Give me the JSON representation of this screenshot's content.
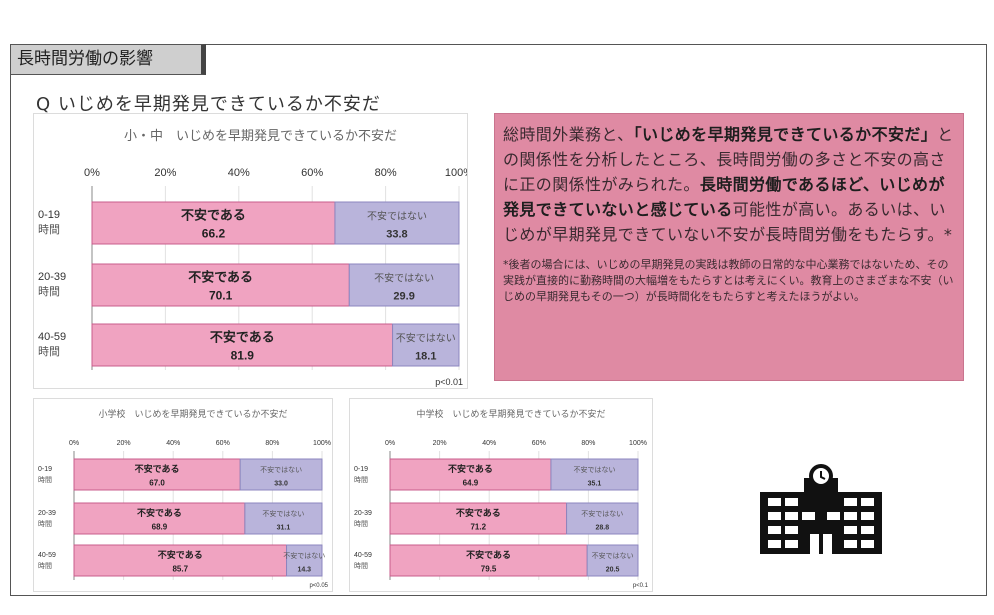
{
  "section_tab": "長時間労働の影響",
  "question": "Q いじめを早期発見できているか不安だ",
  "text_box": {
    "line_parts": [
      {
        "t": "総時間外業務と、",
        "b": false
      },
      {
        "t": "「いじめを早期発見できているか不安だ」",
        "b": true
      },
      {
        "t": "との関係性を分析したところ、長時間労働の多さと不安の高さに正の関係性がみられた。",
        "b": false
      },
      {
        "t": "長時間労働であるほど、いじめが発見できていないと感じている",
        "b": true
      },
      {
        "t": "可能性が高い。あるいは、いじめが早期発見できていない不安が長時間労働をもたらす。*",
        "b": false
      }
    ],
    "note": "*後者の場合には、いじめの早期発見の実践は教師の日常的な中心業務ではないため、その実践が直接的に勤務時間の大幅増をもたらすとは考えにくい。教育上のさまざまな不安（いじめの早期発見もその一つ）が長時間化をもたらすと考えたほうがよい。"
  },
  "colors": {
    "anxious": "#f0a3c1",
    "not_anxious": "#b9b4db",
    "text_box": "#df8aa3"
  },
  "building_icon": "school-building-icon",
  "chart_data": [
    {
      "type": "bar",
      "orientation": "horizontal-stacked-100",
      "title": "小・中　いじめを早期発見できているか不安だ",
      "x_ticks": [
        "0%",
        "20%",
        "40%",
        "60%",
        "80%",
        "100%"
      ],
      "categories": [
        [
          "0-19",
          "時間"
        ],
        [
          "20-39",
          "時間"
        ],
        [
          "40-59",
          "時間"
        ]
      ],
      "series": [
        {
          "name": "不安である",
          "values": [
            66.2,
            70.1,
            81.9
          ],
          "labels": [
            "66.2",
            "70.1",
            "81.9"
          ]
        },
        {
          "name": "不安ではない",
          "values": [
            33.8,
            29.9,
            18.1
          ],
          "labels": [
            "33.8",
            "29.9",
            "18.1"
          ]
        }
      ],
      "note": "p<0.01",
      "xlim": [
        0,
        100
      ]
    },
    {
      "type": "bar",
      "orientation": "horizontal-stacked-100",
      "title": "小学校　いじめを早期発見できているか不安だ",
      "x_ticks": [
        "0%",
        "20%",
        "40%",
        "60%",
        "80%",
        "100%"
      ],
      "categories": [
        [
          "0-19",
          "時間"
        ],
        [
          "20-39",
          "時間"
        ],
        [
          "40-59",
          "時間"
        ]
      ],
      "series": [
        {
          "name": "不安である",
          "values": [
            67.0,
            68.9,
            85.7
          ],
          "labels": [
            "67.0",
            "68.9",
            "85.7"
          ]
        },
        {
          "name": "不安ではない",
          "values": [
            33.0,
            31.1,
            14.3
          ],
          "labels": [
            "33.0",
            "31.1",
            "14.3"
          ]
        }
      ],
      "note": "p<0.05",
      "xlim": [
        0,
        100
      ]
    },
    {
      "type": "bar",
      "orientation": "horizontal-stacked-100",
      "title": "中学校　いじめを早期発見できているか不安だ",
      "x_ticks": [
        "0%",
        "20%",
        "40%",
        "60%",
        "80%",
        "100%"
      ],
      "categories": [
        [
          "0-19",
          "時間"
        ],
        [
          "20-39",
          "時間"
        ],
        [
          "40-59",
          "時間"
        ]
      ],
      "series": [
        {
          "name": "不安である",
          "values": [
            64.9,
            71.2,
            79.5
          ],
          "labels": [
            "64.9",
            "71.2",
            "79.5"
          ]
        },
        {
          "name": "不安ではない",
          "values": [
            35.1,
            28.8,
            20.5
          ],
          "labels": [
            "35.1",
            "28.8",
            "20.5"
          ]
        }
      ],
      "note": "p<0.1",
      "xlim": [
        0,
        100
      ]
    }
  ]
}
